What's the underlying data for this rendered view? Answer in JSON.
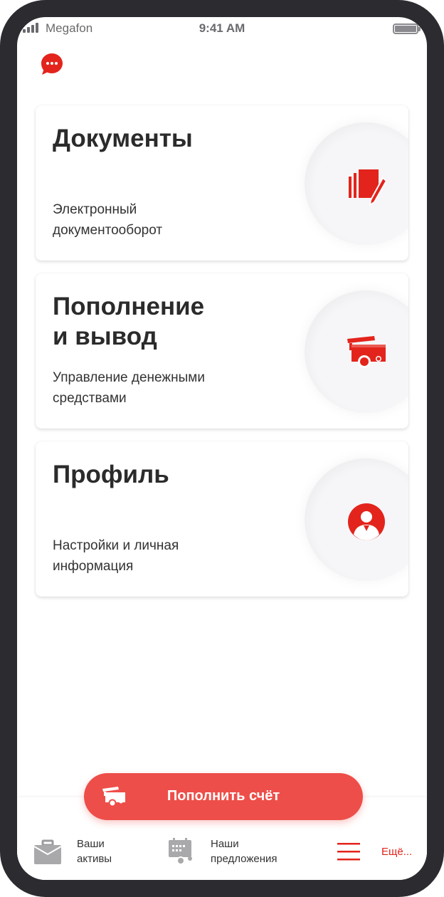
{
  "status_bar": {
    "carrier": "Megafon",
    "time": "9:41 AM"
  },
  "cards": [
    {
      "title": "Документы",
      "subtitle": "Электронный\nдокументооборот",
      "icon": "documents-pen-icon"
    },
    {
      "title": "Пополнение\nи вывод",
      "subtitle": "Управление денежными\nсредствами",
      "icon": "money-cart-icon"
    },
    {
      "title": "Профиль",
      "subtitle": "Настройки и личная\nинформация",
      "icon": "user-profile-icon"
    }
  ],
  "topup_button": {
    "label": "Пополнить счёт",
    "icon": "money-cart-icon"
  },
  "bottom_nav": {
    "assets": {
      "label": "Ваши\nактивы",
      "icon": "briefcase-icon"
    },
    "offers": {
      "label": "Наши\nпредложения",
      "icon": "calendar-offers-icon"
    },
    "more": {
      "label": "Ещё...",
      "icon": "menu-icon"
    }
  },
  "colors": {
    "accent": "#e3241c",
    "button": "#ee4e49",
    "frame": "#2b2b30",
    "nav_icon": "#9b9b9e"
  }
}
